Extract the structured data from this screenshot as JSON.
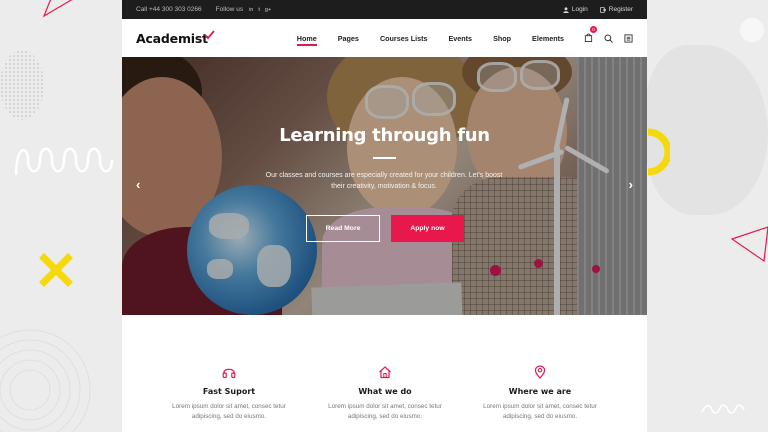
{
  "topbar": {
    "phone": "Call +44 300 303 0266",
    "follow_label": "Follow us",
    "social_icons": [
      "linkedin-icon",
      "twitter-icon",
      "googleplus-icon"
    ],
    "social_glyphs": [
      "in",
      "t",
      "g+"
    ],
    "login_label": "Login",
    "register_label": "Register"
  },
  "header": {
    "logo": "Academist",
    "nav": [
      "Home",
      "Pages",
      "Courses Lists",
      "Events",
      "Shop",
      "Elements"
    ],
    "active_nav": "Home",
    "cart_count": "0"
  },
  "hero": {
    "title": "Learning through fun",
    "text": "Our classes and courses are especially created for your children. Let's boost their creativity, motivation & focus.",
    "primary_button": "Read More",
    "secondary_button": "Apply now"
  },
  "features": [
    {
      "icon": "headphones-icon",
      "title": "Fast Suport",
      "text": "Lorem ipsum dolor sit amet, consec tetur adipiscing, sed do eiusmo."
    },
    {
      "icon": "home-icon",
      "title": "What we do",
      "text": "Lorem ipsum dolor sit amet, consec tetur adipiscing, sed do eiusmo."
    },
    {
      "icon": "location-pin-icon",
      "title": "Where we are",
      "text": "Lorem ipsum dolor sit amet, consec tetur adipiscing, sed do eiusmo."
    }
  ],
  "colors": {
    "accent": "#e8184c",
    "topbar_bg": "#1d1d1d",
    "decor_yellow": "#f5d90a"
  }
}
